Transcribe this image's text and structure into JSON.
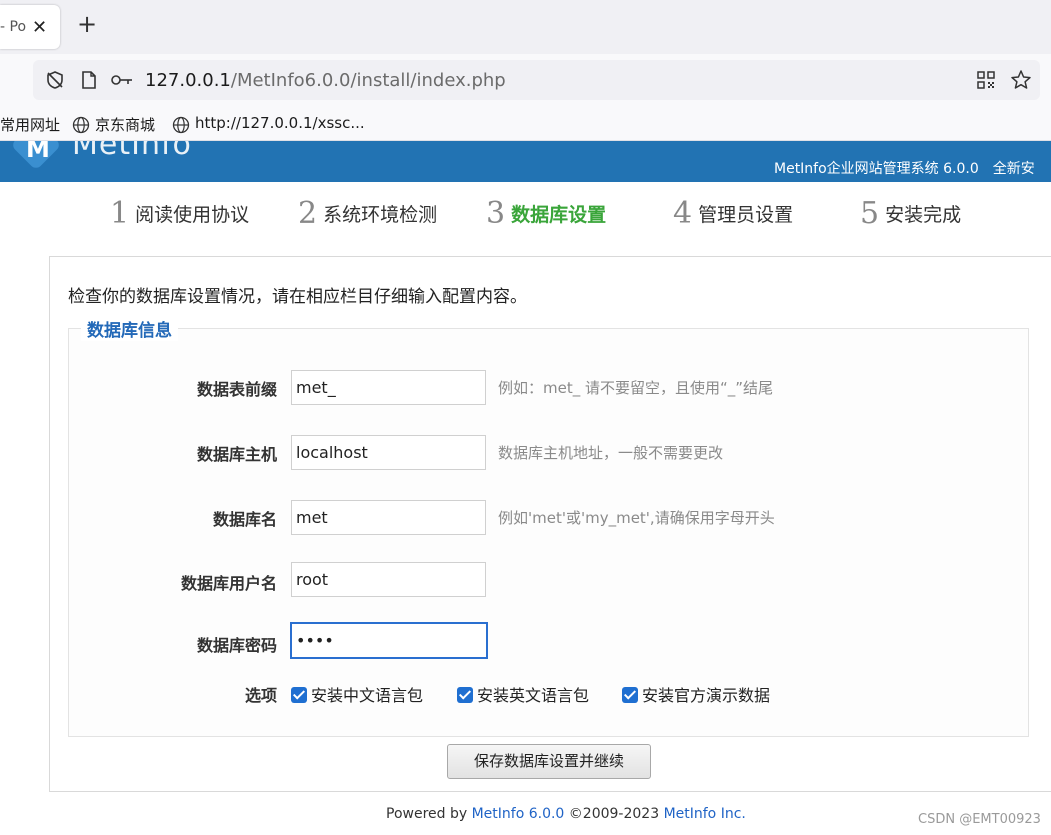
{
  "browser": {
    "tab": {
      "title": "- Po",
      "close_glyph": "✕"
    },
    "new_tab_glyph": "+",
    "url": {
      "host": "127.0.0.1",
      "path": "/MetInfo6.0.0/install/index.php"
    },
    "icons": [
      "shield-off-icon",
      "page-icon",
      "key-icon",
      "qr-code-icon",
      "star-icon",
      "globe-icon"
    ],
    "bookmarks": [
      {
        "label": "常用网址"
      },
      {
        "label": "京东商城"
      },
      {
        "label": "http://127.0.0.1/xssc..."
      }
    ]
  },
  "header": {
    "logo_text": "MetInfo",
    "logo_glyph": "M",
    "system_title": "MetInfo企业网站管理系统 6.0.0",
    "install_type": "全新安"
  },
  "steps": [
    {
      "num": "1",
      "label": "阅读使用协议",
      "active": false
    },
    {
      "num": "2",
      "label": "系统环境检测",
      "active": false
    },
    {
      "num": "3",
      "label": "数据库设置",
      "active": true
    },
    {
      "num": "4",
      "label": "管理员设置",
      "active": false
    },
    {
      "num": "5",
      "label": "安装完成",
      "active": false
    }
  ],
  "form": {
    "intro": "检查你的数据库设置情况，请在相应栏目仔细输入配置内容。",
    "legend": "数据库信息",
    "fields": [
      {
        "label": "数据表前缀",
        "value": "met_",
        "hint": "例如：met_ 请不要留空，且使用“_”结尾"
      },
      {
        "label": "数据库主机",
        "value": "localhost",
        "hint": "数据库主机地址，一般不需要更改"
      },
      {
        "label": "数据库名",
        "value": "met",
        "hint": "例如'met'或'my_met',请确保用字母开头"
      },
      {
        "label": "数据库用户名",
        "value": "root",
        "hint": ""
      },
      {
        "label": "数据库密码",
        "value": "••••",
        "hint": ""
      }
    ],
    "options_label": "选项",
    "options": [
      {
        "label": "安装中文语言包",
        "checked": true
      },
      {
        "label": "安装英文语言包",
        "checked": true
      },
      {
        "label": "安装官方演示数据",
        "checked": true
      }
    ],
    "submit_label": "保存数据库设置并继续"
  },
  "footer": {
    "powered_by": "Powered by ",
    "product_link": "MetInfo 6.0.0",
    "copyright": " ©2009-2023 ",
    "company_link": "MetInfo Inc."
  },
  "watermark": "CSDN @EMT00923",
  "colors": {
    "header_bg": "#2273b3",
    "active_step": "#3aa53a",
    "legend": "#2369b8",
    "checkbox": "#1f6fd1"
  }
}
